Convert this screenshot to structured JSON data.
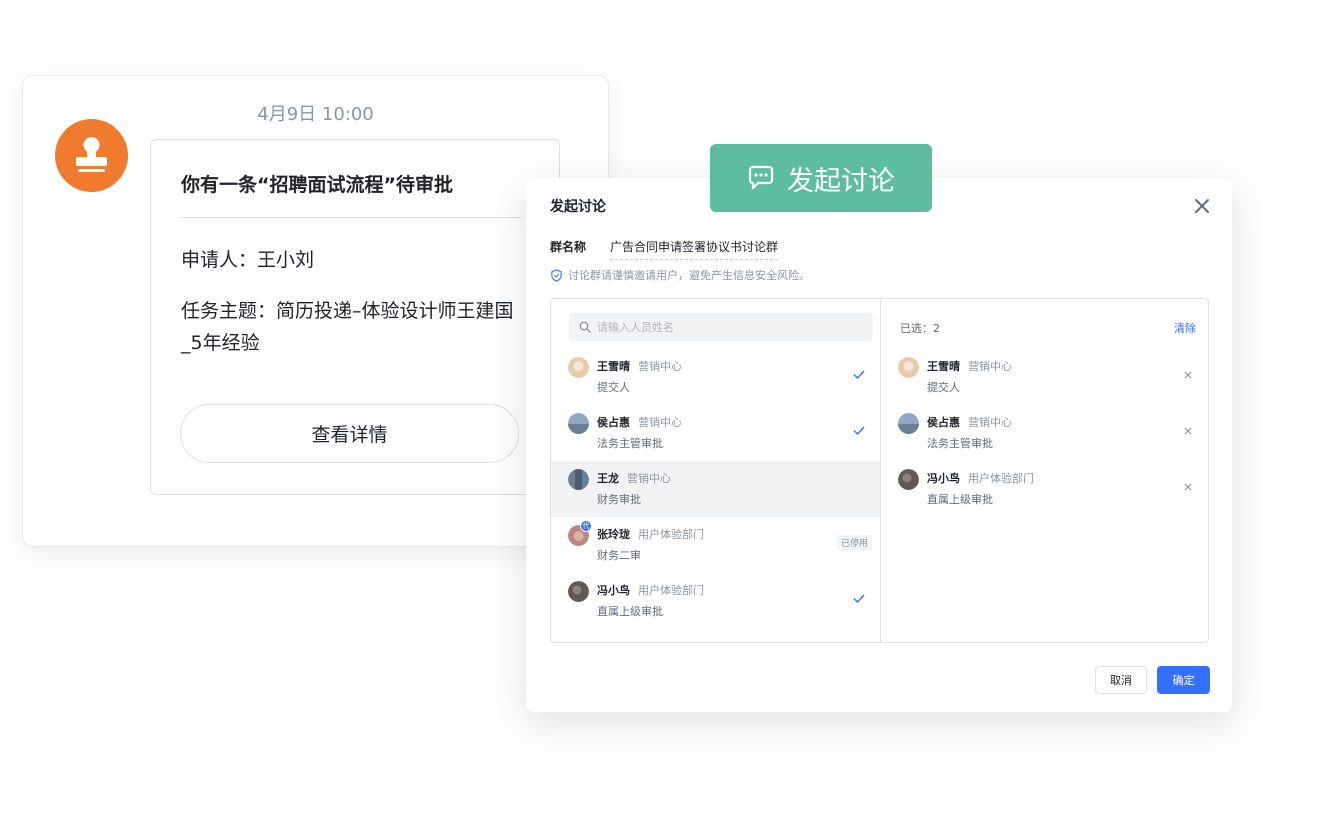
{
  "message": {
    "time": "4月9日 10:00",
    "title": "你有一条“招聘面试流程”待审批",
    "applicant": "申请人：王小刘",
    "subject": "任务主题：简历投递–体验设计师王建国_5年经验",
    "detail_button": "查看详情"
  },
  "badge": {
    "label": "发起讨论"
  },
  "dialog": {
    "title": "发起讨论",
    "group_label": "群名称",
    "group_name": "广告合同申请签署协议书讨论群",
    "hint": "讨论群请谨慎邀请用户，避免产生信息安全风险。",
    "search_placeholder": "请输入人员姓名",
    "members": [
      {
        "name": "王雪晴",
        "dept": "营销中心",
        "role": "提交人",
        "checked": true,
        "avatar_color": "#e8c9a8"
      },
      {
        "name": "侯占惠",
        "dept": "营销中心",
        "role": "法务主管审批",
        "checked": true,
        "avatar_color": "#8ea7c2"
      },
      {
        "name": "王龙",
        "dept": "营销中心",
        "role": "财务审批",
        "checked": false,
        "avatar_color": "#6d7d95"
      },
      {
        "name": "张玲珑",
        "dept": "用户体验部门",
        "role": "财务二审",
        "checked": false,
        "disabled_tag": "已停用",
        "proxy_badge": "代",
        "avatar_color": "#b9887a"
      },
      {
        "name": "冯小鸟",
        "dept": "用户体验部门",
        "role": "直属上级审批",
        "checked": true,
        "avatar_color": "#5f5a57"
      }
    ],
    "selected_count": "已选：2",
    "clear_label": "清除",
    "selected": [
      {
        "name": "王雪晴",
        "dept": "营销中心",
        "role": "提交人",
        "avatar_color": "#e8c9a8"
      },
      {
        "name": "侯占惠",
        "dept": "营销中心",
        "role": "法务主管审批",
        "avatar_color": "#8ea7c2"
      },
      {
        "name": "冯小鸟",
        "dept": "用户体验部门",
        "role": "直属上级审批",
        "avatar_color": "#5f5a57"
      }
    ],
    "cancel_label": "取消",
    "confirm_label": "确定"
  },
  "colors": {
    "accent": "#3370ff",
    "badge_green": "#5ebda0",
    "avatar_orange": "#f07a2d"
  }
}
